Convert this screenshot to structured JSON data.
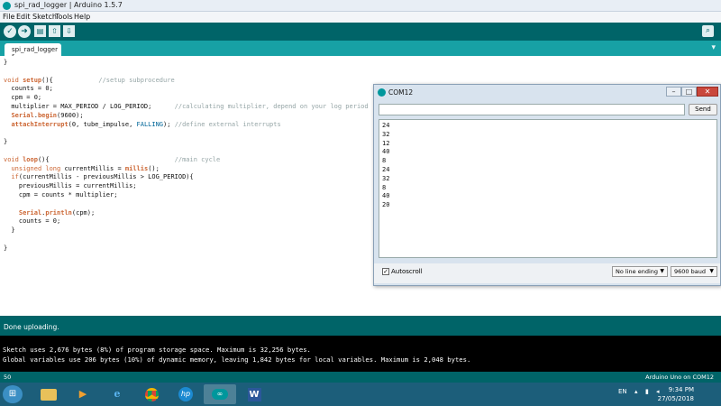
{
  "window": {
    "title": "spi_rad_logger | Arduino 1.5.7"
  },
  "menu": [
    "File",
    "Edit",
    "Sketch",
    "Tools",
    "Help"
  ],
  "toolbar": {
    "verify_icon": "check-icon",
    "upload_icon": "arrow-right-icon",
    "new_icon": "new-file-icon",
    "open_icon": "open-icon",
    "save_icon": "save-icon",
    "serial_icon": "magnifier-icon"
  },
  "tab": {
    "label": "spi_rad_logger §",
    "menu_glyph": "▾"
  },
  "code": {
    "lines": [
      "}",
      "",
      "void setup(){            //setup subprocedure",
      "  counts = 0;",
      "  cpm = 0;",
      "  multiplier = MAX_PERIOD / LOG_PERIOD;      //calculating multiplier, depend on your log period",
      "  Serial.begin(9600);",
      "  attachInterrupt(0, tube_impulse, FALLING); //define external interrupts",
      "",
      "}",
      "",
      "void loop(){                                 //main cycle",
      "  unsigned long currentMillis = millis();",
      "  if(currentMillis - previousMillis > LOG_PERIOD){",
      "    previousMillis = currentMillis;",
      "    cpm = counts * multiplier;",
      "",
      "    Serial.println(cpm);",
      "    counts = 0;",
      "  }",
      "",
      "}"
    ]
  },
  "serial_monitor": {
    "title": "COM12",
    "input_value": "",
    "send_label": "Send",
    "output": [
      "24",
      "32",
      "12",
      "40",
      "8",
      "24",
      "32",
      "8",
      "40",
      "20"
    ],
    "autoscroll_label": "Autoscroll",
    "autoscroll_checked": true,
    "line_ending": "No line ending",
    "baud": "9600 baud",
    "controls": {
      "minimize": "–",
      "maximize": "□",
      "close": "✕"
    }
  },
  "status": {
    "message": "Done uploading."
  },
  "console": {
    "lines": [
      "Sketch uses 2,676 bytes (8%) of program storage space. Maximum is 32,256 bytes.",
      "Global variables use 206 bytes (10%) of dynamic memory, leaving 1,842 bytes for local variables. Maximum is 2,048 bytes."
    ]
  },
  "footer": {
    "line_number": "50",
    "board": "Arduino Uno on COM12"
  },
  "taskbar": {
    "apps": [
      "file-explorer-icon",
      "media-player-icon",
      "internet-explorer-icon",
      "chrome-icon",
      "hp-icon",
      "arduino-icon",
      "word-icon"
    ],
    "language": "EN",
    "time": "9:34 PM",
    "date": "27/05/2018"
  },
  "colors": {
    "accent": "#006468",
    "tab_bar": "#17a1a5",
    "keyword": "#cc6633",
    "comment": "#95a5a6"
  }
}
